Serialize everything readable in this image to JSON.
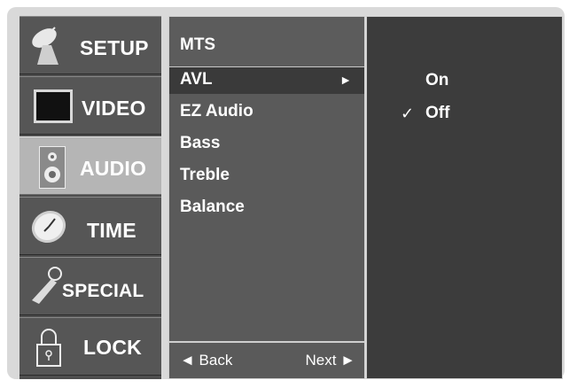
{
  "categories": [
    {
      "label": "SETUP",
      "icon": "satellite-dish-icon"
    },
    {
      "label": "VIDEO",
      "icon": "tv-screen-icon"
    },
    {
      "label": "AUDIO",
      "icon": "speaker-icon"
    },
    {
      "label": "TIME",
      "icon": "clock-icon"
    },
    {
      "label": "SPECIAL",
      "icon": "key-icon"
    },
    {
      "label": "LOCK",
      "icon": "padlock-icon"
    }
  ],
  "active_category": "AUDIO",
  "menu": {
    "title": "MTS",
    "items": [
      "AVL",
      "EZ Audio",
      "Bass",
      "Treble",
      "Balance"
    ],
    "selected": "AVL",
    "selected_arrow": "►",
    "back_label": "◄ Back",
    "next_label": "Next ►"
  },
  "options": {
    "items": [
      "On",
      "Off"
    ],
    "checked": "Off",
    "check_mark": "✓"
  }
}
